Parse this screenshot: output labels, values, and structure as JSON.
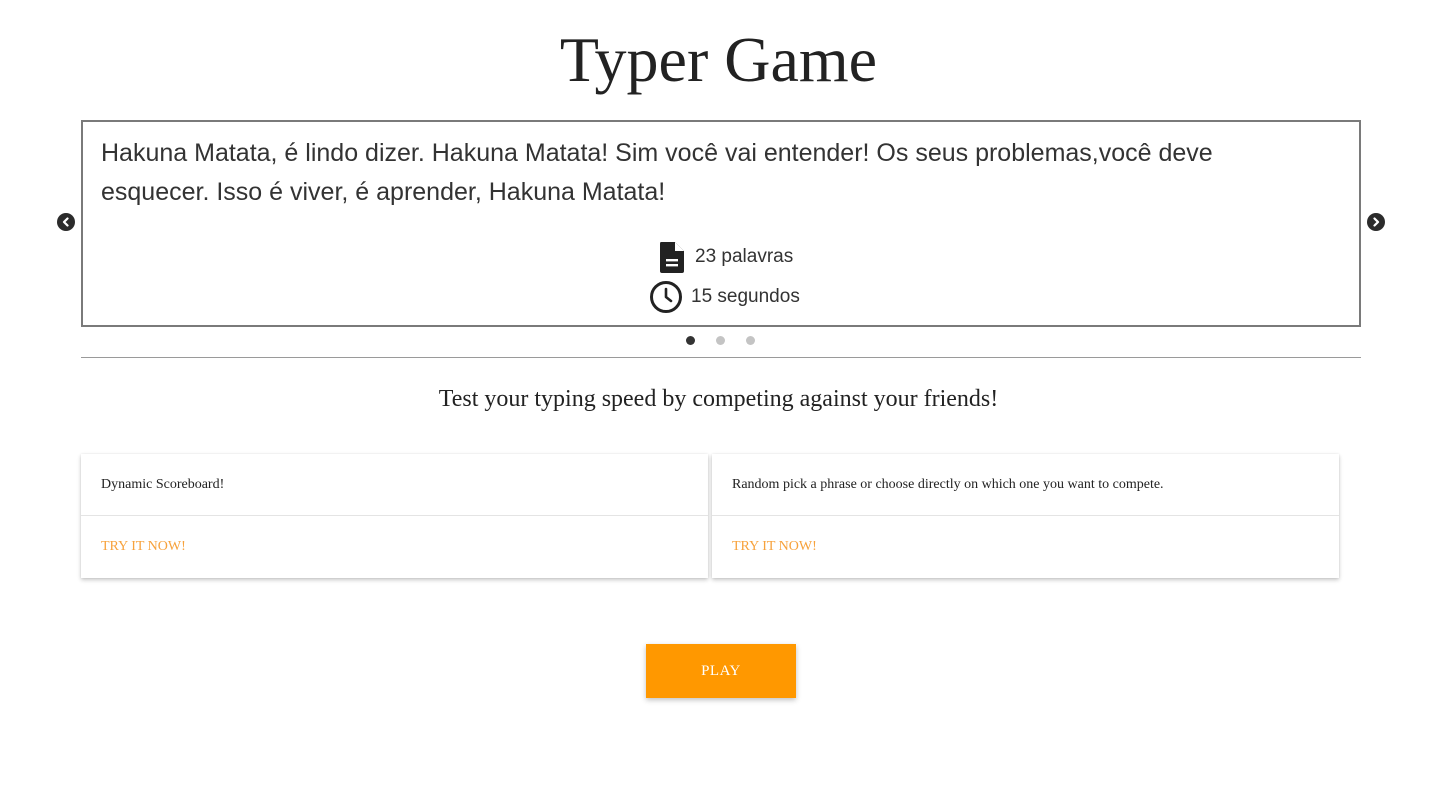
{
  "header": {
    "title": "Typer Game"
  },
  "carousel": {
    "phrase": "Hakuna Matata, é lindo dizer. Hakuna Matata! Sim você vai entender! Os seus problemas,você deve esquecer. Isso é viver, é aprender, Hakuna Matata!",
    "words_label": "23 palavras",
    "time_label": "15 segundos",
    "words_icon": "document-icon",
    "time_icon": "clock-icon",
    "prev_icon": "chevron-left-circle-icon",
    "next_icon": "chevron-right-circle-icon",
    "slide_count": 3,
    "active_slide": 1
  },
  "tagline": "Test your typing speed by competing against your friends!",
  "cards": [
    {
      "text": "Dynamic Scoreboard!",
      "action": "TRY IT NOW!"
    },
    {
      "text": "Random pick a phrase or choose directly on which one you want to compete.",
      "action": "TRY IT NOW!"
    }
  ],
  "play_button": "PLAY",
  "colors": {
    "accent": "#ff9800",
    "link": "#f7a23c",
    "border": "#7a7a7a"
  }
}
